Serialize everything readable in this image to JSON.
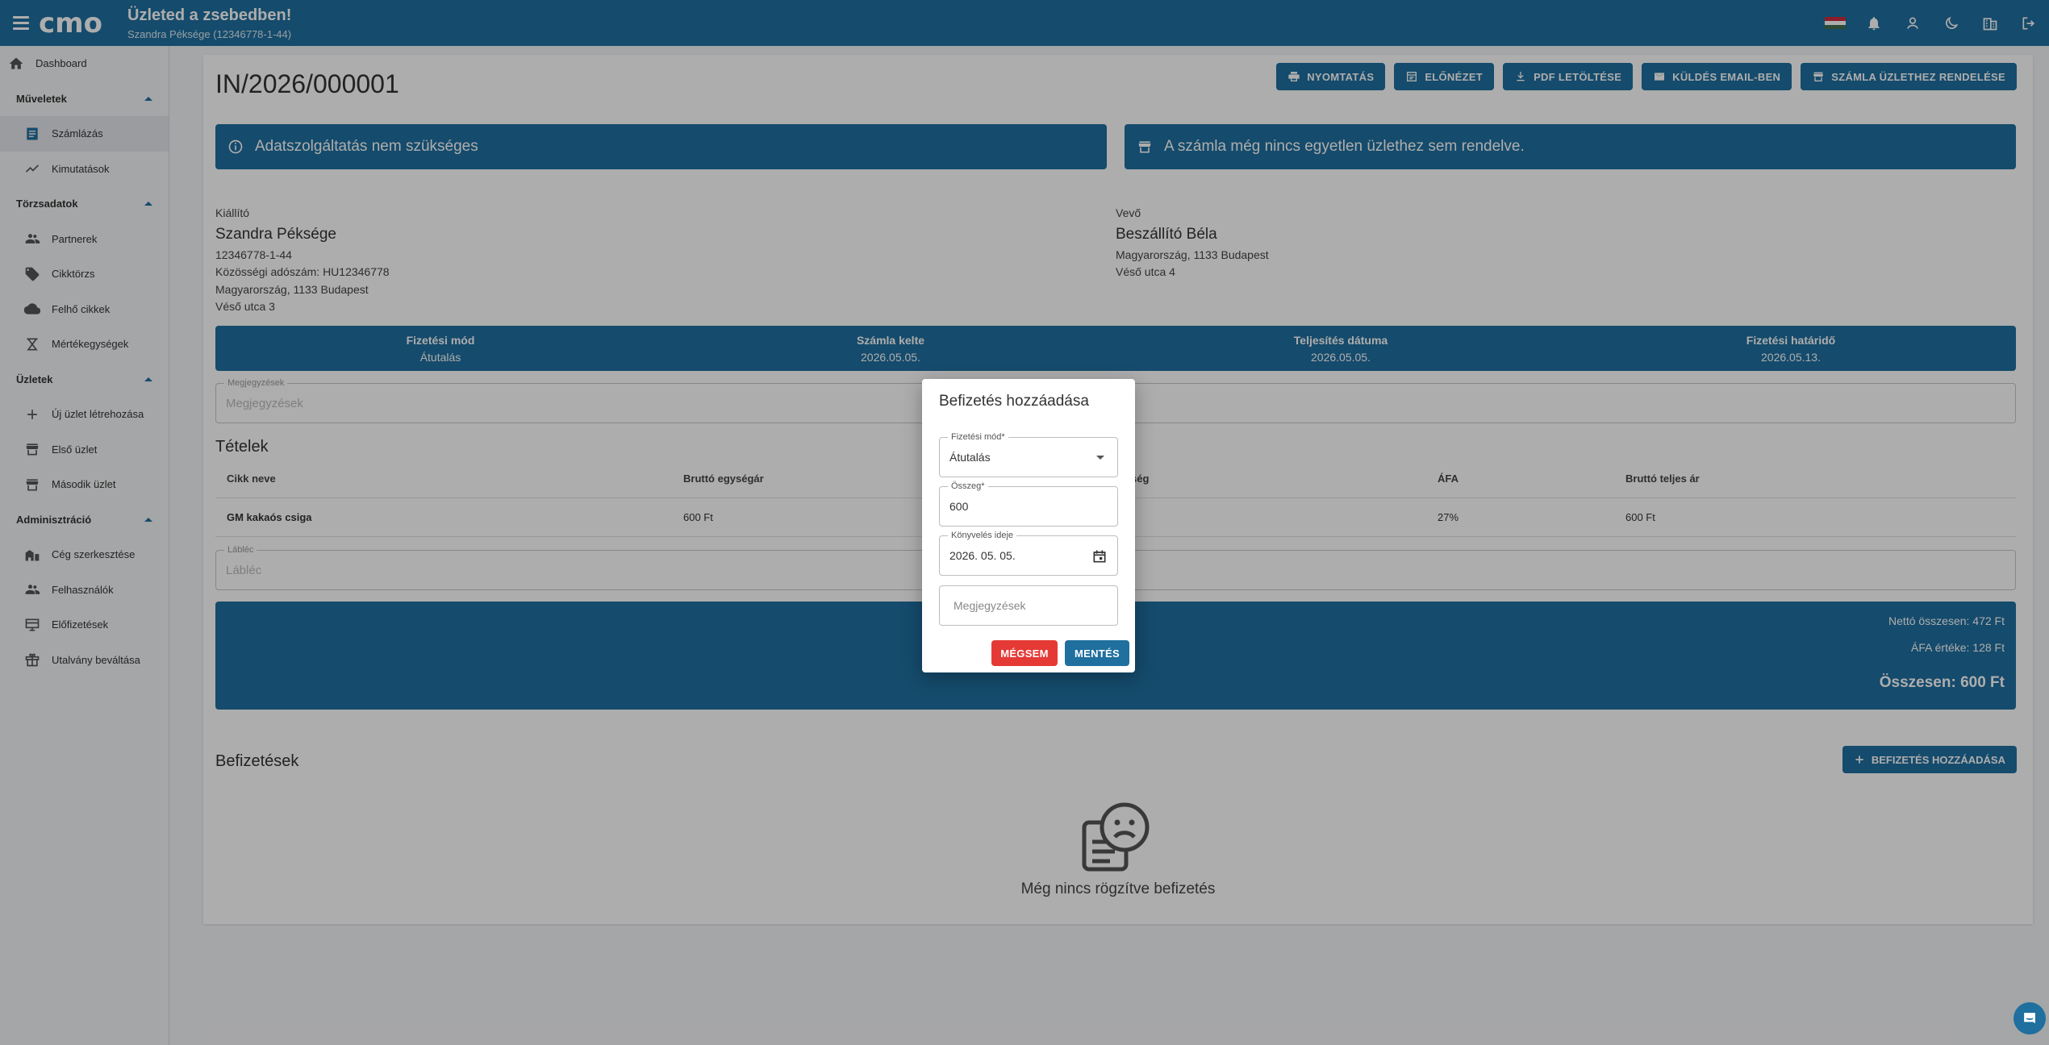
{
  "header": {
    "title": "Üzleted a zsebedben!",
    "subtitle": "Szandra Péksége (12346778-1-44)"
  },
  "sidebar": {
    "dashboard": "Dashboard",
    "sections": [
      {
        "label": "Műveletek",
        "items": [
          "Számlázás",
          "Kimutatások"
        ]
      },
      {
        "label": "Törzsadatok",
        "items": [
          "Partnerek",
          "Cikktörzs",
          "Felhő cikkek",
          "Mértékegységek"
        ]
      },
      {
        "label": "Üzletek",
        "items": [
          "Új üzlet létrehozása",
          "Első üzlet",
          "Második üzlet"
        ]
      },
      {
        "label": "Adminisztráció",
        "items": [
          "Cég szerkesztése",
          "Felhasználók",
          "Előfizetések",
          "Utalvány beváltása"
        ]
      }
    ]
  },
  "invoice": {
    "number": "IN/2026/000001",
    "actions": [
      "NYOMTATÁS",
      "ELŐNÉZET",
      "PDF LETÖLTÉSE",
      "KÜLDÉS EMAIL-BEN",
      "SZÁMLA ÜZLETHEZ RENDELÉSE"
    ],
    "alert_left": "Adatszolgáltatás nem szükséges",
    "alert_right": "A számla még nincs egyetlen üzlethez sem rendelve.",
    "issuer": {
      "label": "Kiállító",
      "name": "Szandra Péksége",
      "tax": "12346778-1-44",
      "eu_tax": "Közösségi adószám: HU12346778",
      "address1": "Magyarország, 1133 Budapest",
      "address2": "Véső utca 3"
    },
    "buyer": {
      "label": "Vevő",
      "name": "Beszállító Béla",
      "address1": "Magyarország, 1133 Budapest",
      "address2": "Véső utca 4"
    },
    "info": [
      {
        "label": "Fizetési mód",
        "value": "Átutalás"
      },
      {
        "label": "Számla kelte",
        "value": "2026.05.05."
      },
      {
        "label": "Teljesítés dátuma",
        "value": "2026.05.05."
      },
      {
        "label": "Fizetési határidő",
        "value": "2026.05.13."
      }
    ],
    "notes_label": "Megjegyzések",
    "notes_placeholder": "Megjegyzések",
    "items_title": "Tételek",
    "columns": [
      "Cikk neve",
      "Bruttó egységár",
      "",
      "ség",
      "ÁFA",
      "Bruttó teljes ár"
    ],
    "rows": [
      {
        "name": "GM kakaós csiga",
        "unit_price": "600 Ft",
        "vat": "27%",
        "total": "600 Ft"
      }
    ],
    "footer_label": "Lábléc",
    "footer_placeholder": "Lábléc",
    "net_total": "Nettó összesen: 472 Ft",
    "vat_total": "ÁFA értéke: 128 Ft",
    "grand_total": "Összesen: 600 Ft",
    "payments_title": "Befizetések",
    "add_payment": "BEFIZETÉS HOZZÁADÁSA",
    "empty_payments": "Még nincs rögzítve befizetés"
  },
  "dialog": {
    "title": "Befizetés hozzáadása",
    "method_label": "Fizetési mód*",
    "method_value": "Átutalás",
    "amount_label": "Összeg*",
    "amount_value": "600",
    "date_label": "Könyvelés ideje",
    "date_value": "2026. 05. 05.",
    "notes_placeholder": "Megjegyzések",
    "cancel": "MÉGSEM",
    "save": "MENTÉS"
  },
  "colors": {
    "primary": "#1f6f9f",
    "danger": "#e53935"
  }
}
